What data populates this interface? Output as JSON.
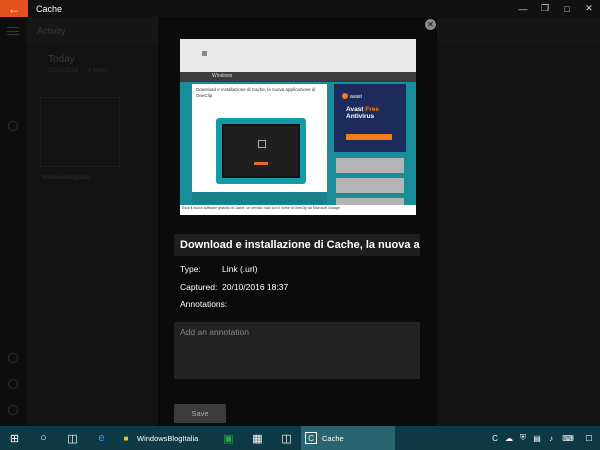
{
  "window": {
    "title": "Cache",
    "back_icon": "arrow-left-icon"
  },
  "background_app": {
    "section": "Activity",
    "today_label": "Today",
    "date": "20/10/2016",
    "count": "4 items",
    "item_label": "WindowsBlogItalia"
  },
  "preview": {
    "nav_text": "Windows",
    "headline": "Download e installazione di Cache, la nuova applicazione di OneClip",
    "ad_brand": "avast",
    "ad_line1": "Avast",
    "ad_line2": "Free",
    "ad_line3": "Antivirus",
    "caption": "Ecco il nuovo software gratuito di Cache, un servizio nato con il nome di OneClip da Microsoft Garage"
  },
  "dialog": {
    "title": "Download e installazione di Cache, la nuova appli",
    "type_label": "Type:",
    "type_value": "Link (.url)",
    "captured_label": "Captured:",
    "captured_value": "20/10/2016 18:37",
    "annotations_label": "Annotations:",
    "annotation_placeholder": "Add an annotation",
    "save_label": "Save"
  },
  "taskbar": {
    "apps": [
      {
        "label": "WindowsBlogItalia"
      },
      {
        "label": "Cache"
      }
    ]
  }
}
